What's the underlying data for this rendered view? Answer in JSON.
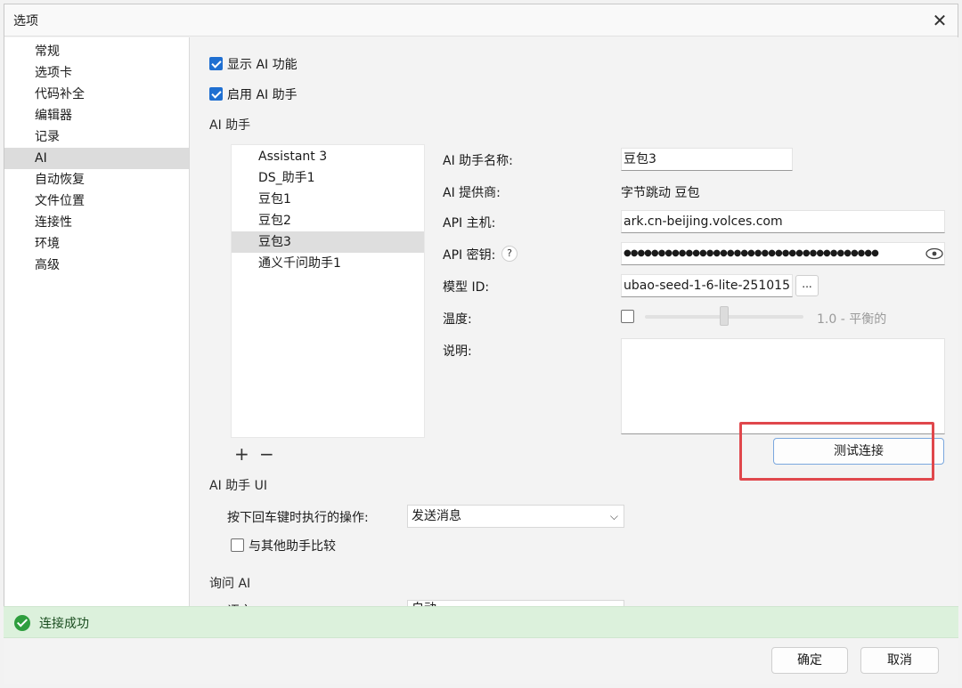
{
  "window": {
    "title": "选项",
    "close_glyph": "✕"
  },
  "sidebar": {
    "items": [
      {
        "label": "常规"
      },
      {
        "label": "选项卡"
      },
      {
        "label": "代码补全"
      },
      {
        "label": "编辑器"
      },
      {
        "label": "记录"
      },
      {
        "label": "AI"
      },
      {
        "label": "自动恢复"
      },
      {
        "label": "文件位置"
      },
      {
        "label": "连接性"
      },
      {
        "label": "环境"
      },
      {
        "label": "高级"
      }
    ],
    "selected": "AI"
  },
  "ai": {
    "show_ai": {
      "label": "显示 AI 功能",
      "checked": true
    },
    "enable_assistant": {
      "label": "启用 AI 助手",
      "checked": true
    },
    "assistant_section": "AI 助手",
    "assistants": [
      {
        "label": "Assistant 3"
      },
      {
        "label": "DS_助手1"
      },
      {
        "label": "豆包1"
      },
      {
        "label": "豆包2"
      },
      {
        "label": "豆包3"
      },
      {
        "label": "通义千问助手1"
      }
    ],
    "selected_assistant": "豆包3",
    "add_glyph": "+",
    "remove_glyph": "−",
    "fields": {
      "name_label": "AI 助手名称:",
      "name_value": "豆包3",
      "provider_label": "AI 提供商:",
      "provider_value": "字节跳动 豆包",
      "host_label": "API 主机:",
      "host_value": "ark.cn-beijing.volces.com",
      "key_label": "API 密钥:",
      "key_help": "?",
      "key_value": "●●●●●●●●●●●●●●●●●●●●●●●●●●●●●●●●●●●●●",
      "model_label": "模型 ID:",
      "model_value": "ubao-seed-1-6-lite-251015",
      "model_browse": "...",
      "temp_label": "温度:",
      "temp_enabled": false,
      "temp_value": "1.0 - 平衡的",
      "desc_label": "说明:",
      "desc_value": ""
    },
    "test_button": "测试连接",
    "ui_section": "AI 助手 UI",
    "enter_action_label": "按下回车键时执行的操作:",
    "enter_action_value": "发送消息",
    "compare": {
      "label": "与其他助手比较",
      "checked": false
    },
    "ask_section": "询问 AI",
    "language_label": "语言:",
    "language_value": "自动"
  },
  "status": {
    "text": "连接成功",
    "icon": "check-circle-icon",
    "color": "#2e9e3e"
  },
  "footer": {
    "ok": "确定",
    "cancel": "取消"
  },
  "colors": {
    "accent": "#1f6fd1",
    "highlight": "#e0474c",
    "status_bg": "#dcf1dc"
  }
}
